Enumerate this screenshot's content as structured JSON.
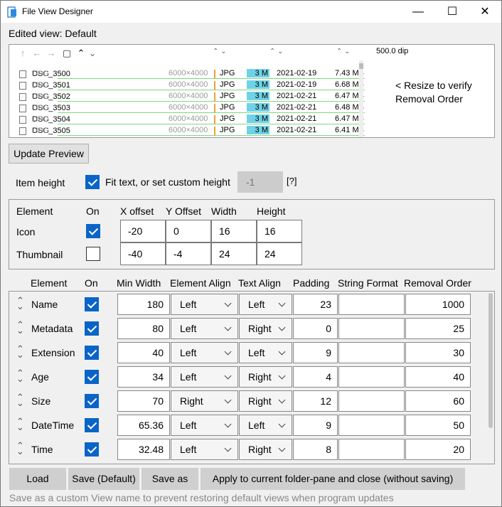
{
  "window": {
    "title": "File View Designer",
    "min_glyph": "—",
    "max_glyph": "☐",
    "close_glyph": "✕"
  },
  "edited_view": "Edited view: Default",
  "preview": {
    "toolbar_icons": [
      "up-arrow-icon",
      "back-icon",
      "forward-icon",
      "folder-icon",
      "chevron-up-icon",
      "chevron-down-icon"
    ],
    "toolbar_glyphs": [
      "↑",
      "←",
      "→",
      "▢",
      "⌃",
      "⌄"
    ],
    "width_label": "500.0 dip",
    "files": [
      {
        "name": "DSC_3500",
        "ext_label": ".JPG",
        "meta": "6000×4000",
        "ext": "JPG",
        "age": "3 M",
        "date": "2021-02-19",
        "size": "7.43 MB"
      },
      {
        "name": "DSC_3501",
        "ext_label": ".JPG",
        "meta": "6000×4000",
        "ext": "JPG",
        "age": "3 M",
        "date": "2021-02-19",
        "size": "6.68 MB"
      },
      {
        "name": "DSC_3502",
        "ext_label": ".JPG",
        "meta": "6000×4000",
        "ext": "JPG",
        "age": "3 M",
        "date": "2021-02-21",
        "size": "6.47 MB"
      },
      {
        "name": "DSC_3503",
        "ext_label": ".JPG",
        "meta": "6000×4000",
        "ext": "JPG",
        "age": "3 M",
        "date": "2021-02-21",
        "size": "6.48 MB"
      },
      {
        "name": "DSC_3504",
        "ext_label": ".JPG",
        "meta": "6000×4000",
        "ext": "JPG",
        "age": "3 M",
        "date": "2021-02-21",
        "size": "6.47 MB"
      },
      {
        "name": "DSC_3505",
        "ext_label": ".JPG",
        "meta": "6000×4000",
        "ext": "JPG",
        "age": "3 M",
        "date": "2021-02-21",
        "size": "6.41 MB"
      }
    ],
    "resize_note_line1": "< Resize to verify",
    "resize_note_line2": "Removal Order"
  },
  "update_preview_label": "Update Preview",
  "item_height": {
    "label": "Item height",
    "fit_checked": true,
    "fit_label": "Fit text, or set custom height",
    "custom_value": "-1",
    "help": "[?]"
  },
  "element_table": {
    "headers": {
      "element": "Element",
      "on": "On",
      "x": "X offset",
      "y": "Y Offset",
      "w": "Width",
      "h": "Height"
    },
    "rows": [
      {
        "name": "Icon",
        "on": true,
        "x": "-20",
        "y": "0",
        "w": "16",
        "h": "16"
      },
      {
        "name": "Thumbnail",
        "on": false,
        "x": "-40",
        "y": "-4",
        "w": "24",
        "h": "24"
      }
    ]
  },
  "column_table": {
    "headers": {
      "element": "Element",
      "on": "On",
      "min_width": "Min Width",
      "el_align": "Element Align",
      "text_align": "Text Align",
      "padding": "Padding",
      "string_format": "String Format",
      "removal": "Removal Order"
    },
    "rows": [
      {
        "name": "Name",
        "on": true,
        "min_width": "180",
        "el_align": "Left",
        "text_align": "Left",
        "padding": "23",
        "string_format": "",
        "removal": "1000"
      },
      {
        "name": "Metadata",
        "on": true,
        "min_width": "80",
        "el_align": "Left",
        "text_align": "Right",
        "padding": "0",
        "string_format": "",
        "removal": "25"
      },
      {
        "name": "Extension",
        "on": true,
        "min_width": "40",
        "el_align": "Left",
        "text_align": "Left",
        "padding": "9",
        "string_format": "",
        "removal": "30"
      },
      {
        "name": "Age",
        "on": true,
        "min_width": "34",
        "el_align": "Left",
        "text_align": "Right",
        "padding": "4",
        "string_format": "",
        "removal": "40"
      },
      {
        "name": "Size",
        "on": true,
        "min_width": "70",
        "el_align": "Right",
        "text_align": "Right",
        "padding": "12",
        "string_format": "",
        "removal": "60"
      },
      {
        "name": "DateTime",
        "on": true,
        "min_width": "65.36",
        "el_align": "Left",
        "text_align": "Left",
        "padding": "9",
        "string_format": "",
        "removal": "50"
      },
      {
        "name": "Time",
        "on": true,
        "min_width": "32.48",
        "el_align": "Left",
        "text_align": "Right",
        "padding": "8",
        "string_format": "",
        "removal": "20"
      }
    ]
  },
  "buttons": {
    "load": "Load",
    "save_default": "Save (Default)",
    "save_as": "Save as",
    "apply": "Apply to current folder-pane and close (without saving)"
  },
  "footer_note": "Save as a custom View name to prevent restoring default views when program updates"
}
